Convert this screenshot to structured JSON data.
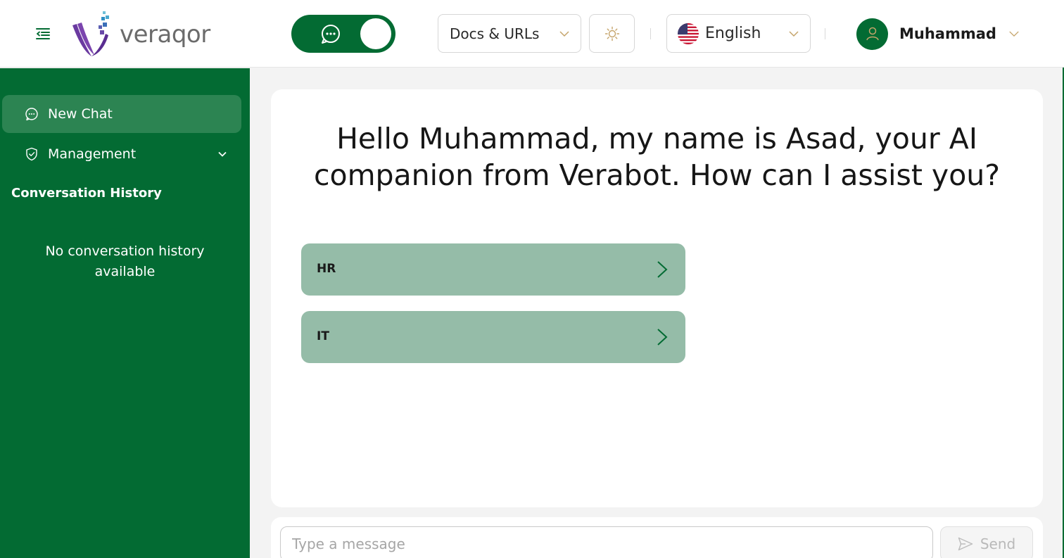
{
  "header": {
    "logo_text": "veraqor",
    "docs_select": {
      "selected": "Docs & URLs"
    },
    "language_select": {
      "selected": "English"
    },
    "user": {
      "name": "Muhammad"
    }
  },
  "sidebar": {
    "items": [
      {
        "label": "New Chat",
        "icon": "chat-bubble-icon"
      },
      {
        "label": "Management",
        "icon": "shield-check-icon"
      }
    ],
    "history_title": "Conversation History",
    "history_empty": "No conversation history available"
  },
  "main": {
    "greeting": "Hello Muhammad, my name is Asad, your AI companion from Verabot. How can I assist you?",
    "topics": [
      {
        "label": "HR"
      },
      {
        "label": "IT"
      }
    ]
  },
  "composer": {
    "placeholder": "Type a message",
    "send_label": "Send"
  },
  "colors": {
    "primary": "#036b33",
    "sidebar_active": "#2c8452",
    "topic_bg": "#95bca8",
    "accent_chevron": "#c5a46a"
  }
}
